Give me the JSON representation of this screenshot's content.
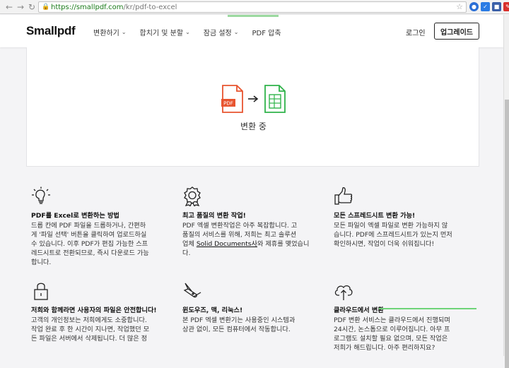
{
  "browser": {
    "url_host": "https://smallpdf.com",
    "url_path": "/kr/pdf-to-excel"
  },
  "header": {
    "logo": "Smallpdf",
    "menu": [
      {
        "label": "변환하기",
        "has_dropdown": true
      },
      {
        "label": "합치기 및 분할",
        "has_dropdown": true
      },
      {
        "label": "잠금 설정",
        "has_dropdown": true
      },
      {
        "label": "PDF 압축",
        "has_dropdown": false
      }
    ],
    "login_label": "로그인",
    "upgrade_label": "업그레이드"
  },
  "converter": {
    "source_label": "PDF",
    "status": "변환 중",
    "colors": {
      "pdf": "#e8542f",
      "excel": "#2fb34a"
    }
  },
  "features": [
    {
      "icon": "lightbulb-icon",
      "title": "PDF를 Excel로 변환하는 방법",
      "lines": [
        "드롭 칸에 PDF 파일을 드롭하거나, 간편하",
        "게 '파일 선택' 버튼을 클릭하여 업로드하실",
        "수 있습니다. 이후 PDF가 편집 가능한 스프",
        "레드시트로 전환되므로, 즉시 다운로드 가능",
        "합니다."
      ]
    },
    {
      "icon": "award-ribbon-icon",
      "title": "최고 품질의 변환 작업!",
      "lines": [
        "PDF 엑셀 변환작업은 아주 복잡합니다. 고",
        "품질의 서비스를 위해, 저희는 최고 솔루션",
        "업체 ",
        "Solid Documents사",
        "와 제휴를 맺었습니",
        "다."
      ]
    },
    {
      "icon": "thumbs-up-icon",
      "title": "모든 스프레드시트 변환 가능!",
      "lines": [
        "모든 파일이 엑셀 파일로 변환 가능하지 않",
        "습니다. PDF에 스프레드시트가 있는지 먼저",
        "확인하시면, 작업이 더욱 쉬워집니다!"
      ]
    },
    {
      "icon": "padlock-icon",
      "title": "저희와 함께라면 사용자의 파일은 안전합니다!",
      "lines": [
        "고객의 개인정보는 저희에게도 소중합니다.",
        "작업 완료 후 한 시간이 지나면, 작업했던 모",
        "든 파일은 서버에서 삭제됩니다. 더 많은 정"
      ]
    },
    {
      "icon": "swiss-knife-icon",
      "title": "윈도우즈, 맥, 리눅스!",
      "lines": [
        "본 PDF 엑셀 변환기는 사용중인 시스템과",
        "상관 없이, 모든 컴퓨터에서 작동합니다."
      ]
    },
    {
      "icon": "cloud-upload-icon",
      "title": "클라우드에서 변환",
      "lines": [
        "PDF 변환 서비스는 클라우드에서 진행되며",
        "24시간, 논스톱으로 이루어집니다. 아무 프",
        "로그램도 설치할 필요 없으며, 모든 작업은",
        "저희가 해드립니다. 아주 편리하지요?"
      ]
    }
  ]
}
